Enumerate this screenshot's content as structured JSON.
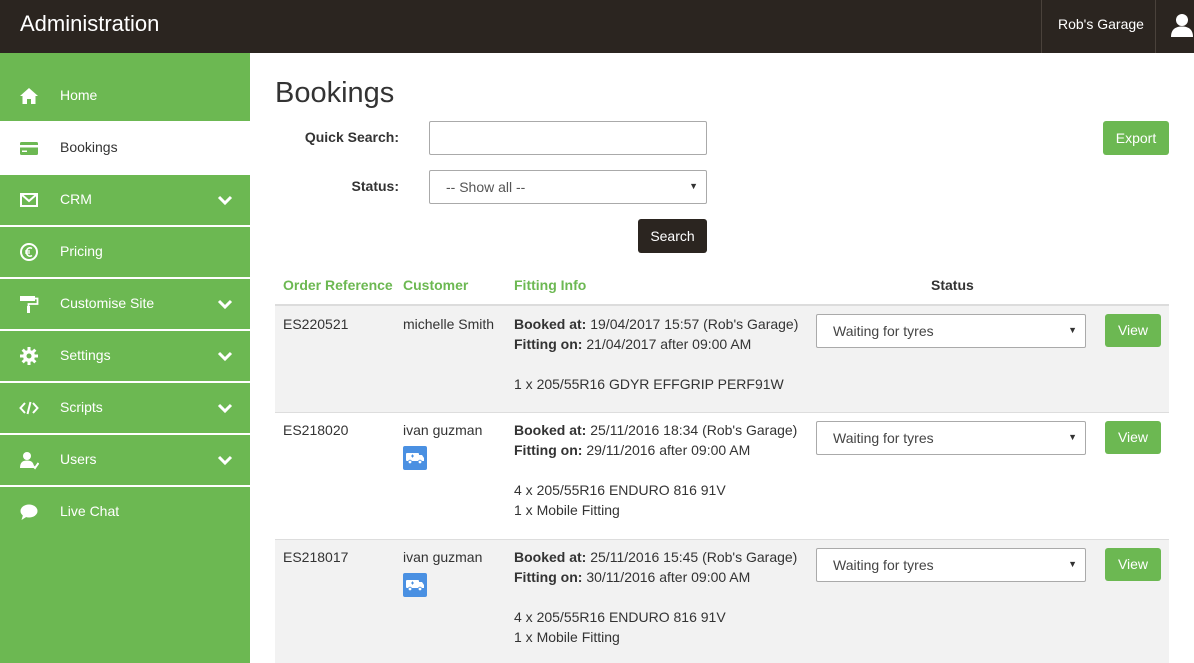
{
  "header": {
    "title": "Administration",
    "garage_name": "Rob's Garage",
    "user_icon": "user-icon"
  },
  "sidebar": {
    "items": [
      {
        "label": "Home",
        "icon": "home-icon",
        "active": false,
        "has_submenu": false
      },
      {
        "label": "Bookings",
        "icon": "card-icon",
        "active": true,
        "has_submenu": false
      },
      {
        "label": "CRM",
        "icon": "envelope-icon",
        "active": false,
        "has_submenu": true
      },
      {
        "label": "Pricing",
        "icon": "euro-icon",
        "active": false,
        "has_submenu": false
      },
      {
        "label": "Customise Site",
        "icon": "paint-roller-icon",
        "active": false,
        "has_submenu": true
      },
      {
        "label": "Settings",
        "icon": "gear-icon",
        "active": false,
        "has_submenu": true
      },
      {
        "label": "Scripts",
        "icon": "code-icon",
        "active": false,
        "has_submenu": true
      },
      {
        "label": "Users",
        "icon": "users-icon",
        "active": false,
        "has_submenu": true
      },
      {
        "label": "Live Chat",
        "icon": "chat-bubble-icon",
        "active": false,
        "has_submenu": false
      }
    ]
  },
  "main": {
    "title": "Bookings",
    "quick_search_label": "Quick Search:",
    "quick_search_value": "",
    "status_label": "Status:",
    "status_selected": "-- Show all --",
    "search_button": "Search",
    "export_button": "Export"
  },
  "table": {
    "columns": [
      "Order Reference",
      "Customer",
      "Fitting Info",
      "Status"
    ],
    "booked_at_label": "Booked at:",
    "fitting_on_label": "Fitting on:",
    "view_label": "View",
    "rows": [
      {
        "ref": "ES220521",
        "customer": "michelle Smith",
        "mobile": false,
        "booked_at": "19/04/2017 15:57 (Rob's Garage)",
        "fitting_on": "21/04/2017 after 09:00 AM",
        "items": [
          "1 x 205/55R16 GDYR EFFGRIP PERF91W"
        ],
        "status": "Waiting for tyres"
      },
      {
        "ref": "ES218020",
        "customer": "ivan guzman",
        "mobile": true,
        "booked_at": "25/11/2016 18:34 (Rob's Garage)",
        "fitting_on": "29/11/2016 after 09:00 AM",
        "items": [
          "4 x 205/55R16 ENDURO 816 91V",
          "1 x Mobile Fitting"
        ],
        "status": "Waiting for tyres"
      },
      {
        "ref": "ES218017",
        "customer": "ivan guzman",
        "mobile": true,
        "booked_at": "25/11/2016 15:45 (Rob's Garage)",
        "fitting_on": "30/11/2016 after 09:00 AM",
        "items": [
          "4 x 205/55R16 ENDURO 816 91V",
          "1 x Mobile Fitting"
        ],
        "status": "Waiting for tyres"
      }
    ]
  },
  "colors": {
    "accent_green": "#6cb852",
    "topbar_dark": "#2b2520",
    "mobile_badge_blue": "#4a90e2"
  }
}
